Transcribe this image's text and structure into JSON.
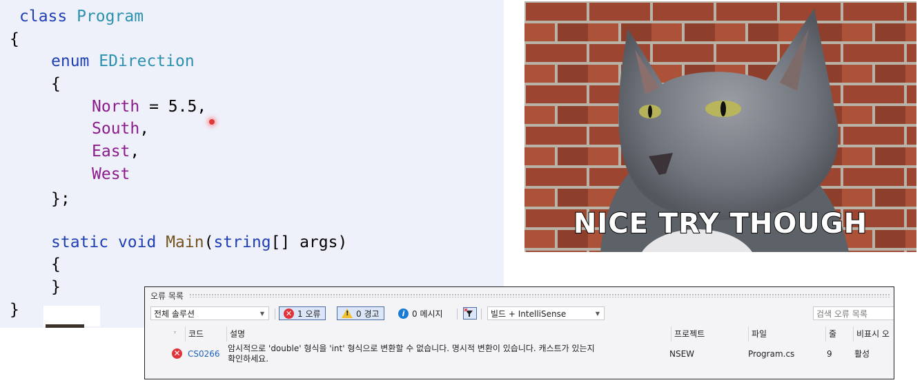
{
  "code": {
    "lines": {
      "l1_kw": "class",
      "l1_name": "Program",
      "l2": "{",
      "l3_kw": "enum",
      "l3_name": "EDirection",
      "l4": "{",
      "l5_member": "North",
      "l5_rest": " = 5.5,",
      "l6_member": "South",
      "l6_rest": ",",
      "l7_member": "East",
      "l7_rest": ",",
      "l8_member": "West",
      "l9": "};",
      "l10_static": "static",
      "l10_void": "void",
      "l10_method": "Main",
      "l10_open": "(",
      "l10_type": "string",
      "l10_rest": "[] args)",
      "l11": "{",
      "l12": "}",
      "l13": "}"
    }
  },
  "meme": {
    "caption": "NICE TRY THOUGH"
  },
  "error_list": {
    "title": "오류 목록",
    "scope": "전체 솔루션",
    "errors_toggle": "1 오류",
    "warnings_toggle": "0 경고",
    "messages_toggle": "0 메시지",
    "build_source": "빌드 + IntelliSense",
    "search_placeholder": "검색 오류 목록",
    "columns": {
      "code": "코드",
      "description": "설명",
      "project": "프로젝트",
      "file": "파일",
      "line": "줄",
      "suppression": "비표시 오"
    },
    "rows": [
      {
        "code": "CS0266",
        "description_1": "암시적으로 'double' 형식을 'int' 형식으로 변환할 수 없습니다. 명시적 변환이 있습니다. 캐스트가 있는지",
        "description_2": "확인하세요.",
        "project": "NSEW",
        "file": "Program.cs",
        "line": "9",
        "suppression": "활성"
      }
    ]
  },
  "colors": {
    "keyword": "#1f3fb5",
    "type": "#2b91af",
    "enum_member": "#8b1c8b",
    "method": "#74531f",
    "error": "#e0333a",
    "warning": "#f2c12e",
    "info": "#1a7ad4"
  }
}
